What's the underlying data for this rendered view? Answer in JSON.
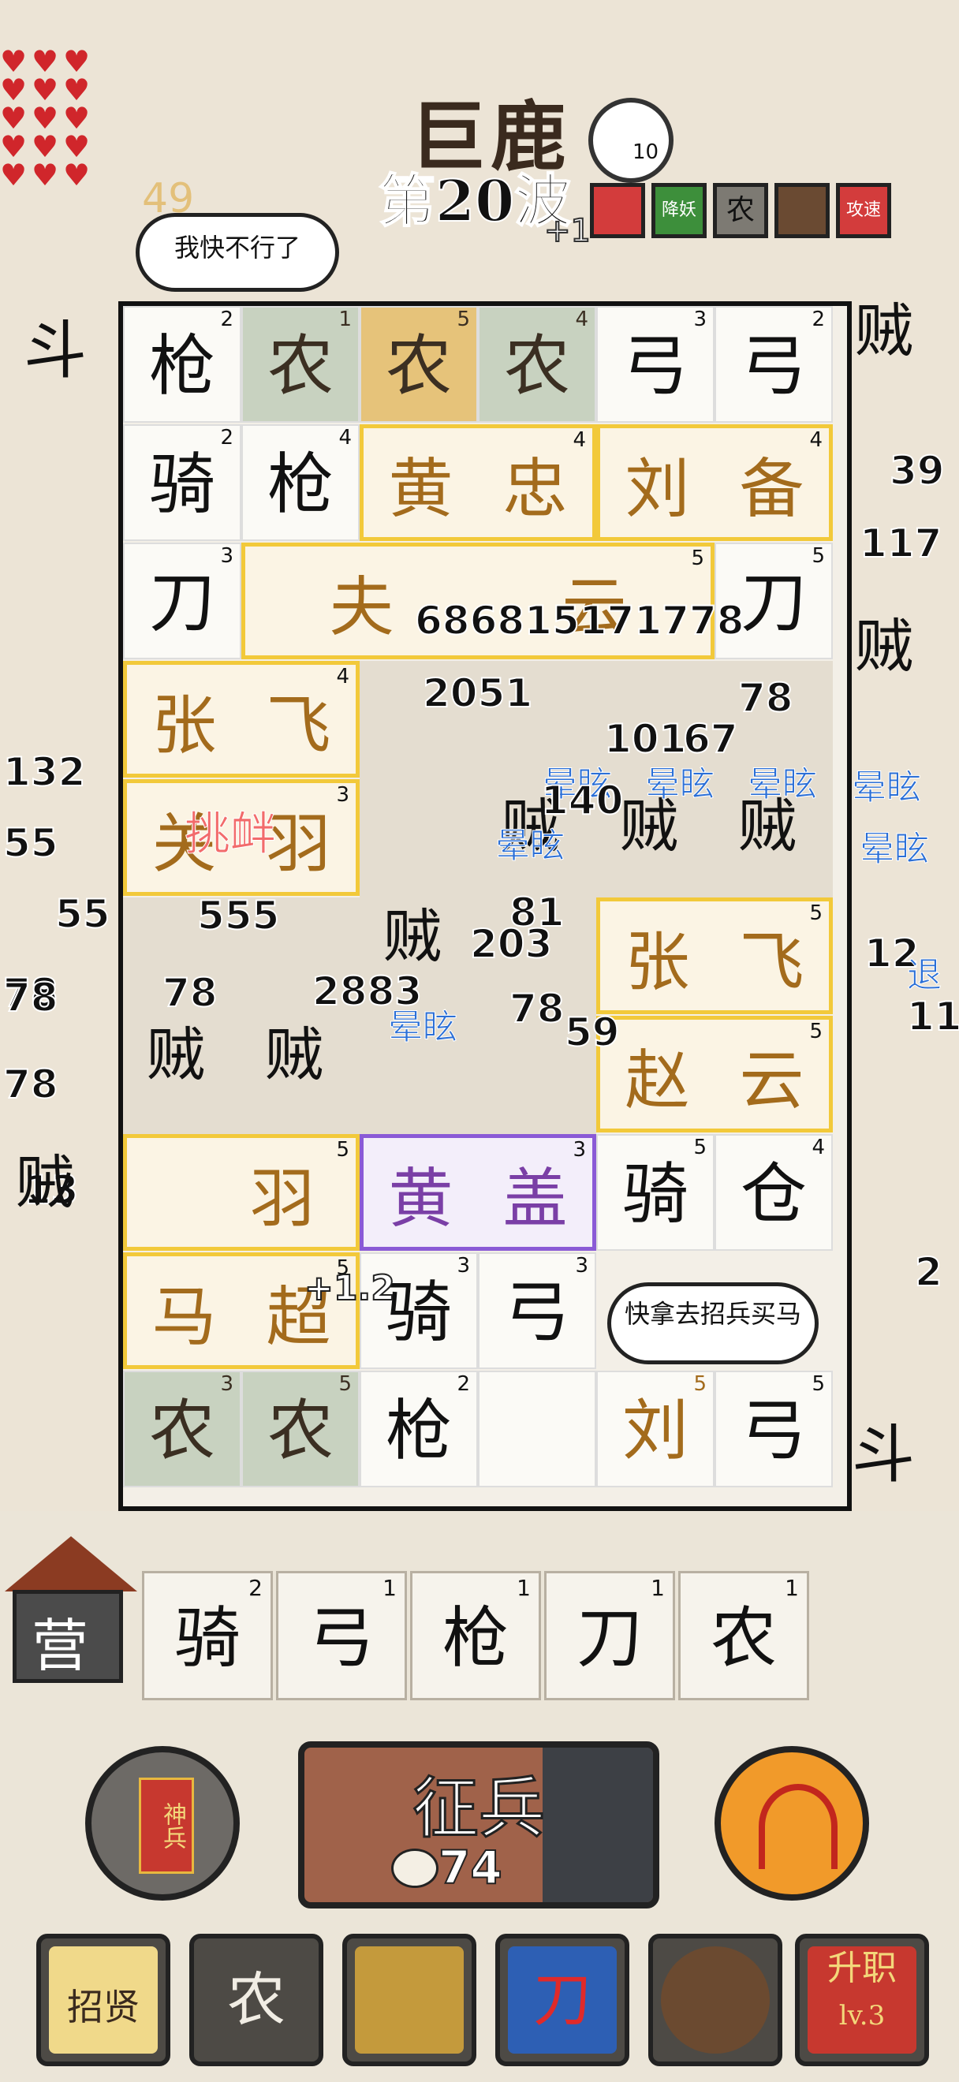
{
  "header": {
    "location": "巨鹿",
    "wave": "第20波",
    "gold": "49",
    "peach_count": "10",
    "income_hint": "+1"
  },
  "buffs": [
    "",
    "降妖",
    "农",
    "",
    "攻速"
  ],
  "bubbles": {
    "left": "我快不行了",
    "right": "快拿去招兵买马"
  },
  "board": {
    "row1": [
      {
        "char": "枪",
        "lv": "2"
      },
      {
        "char": "农",
        "lv": "1"
      },
      {
        "char": "农",
        "lv": "5"
      },
      {
        "char": "农",
        "lv": "4"
      },
      {
        "char": "弓",
        "lv": "3"
      },
      {
        "char": "弓",
        "lv": "2"
      }
    ],
    "row2": [
      {
        "char": "骑",
        "lv": "2"
      },
      {
        "char": "枪",
        "lv": "4"
      }
    ],
    "hero_huangzhong": {
      "name1": "黄",
      "name2": "忠",
      "lv": "4"
    },
    "hero_liubei": {
      "name1": "刘",
      "name2": "备",
      "lv": "4"
    },
    "row3_left": {
      "char": "刀",
      "lv": "3"
    },
    "hero_row3": {
      "name1": "夫",
      "name2": "云",
      "lv": "5"
    },
    "row3_right": {
      "char": "刀",
      "lv": "5"
    },
    "hero_zhangfei_a": {
      "name1": "张",
      "name2": "飞",
      "lv": "4"
    },
    "hero_guanyu": {
      "name1": "关",
      "name2": "羽",
      "lv": "3"
    },
    "hero_zhangfei_b": {
      "name1": "张",
      "name2": "飞",
      "lv": "5"
    },
    "hero_zhaoyun": {
      "name1": "赵",
      "name2": "云",
      "lv": "5"
    },
    "hero_yu": {
      "name1": "",
      "name2": "羽",
      "lv": "5"
    },
    "hero_huanggai": {
      "name1": "黄",
      "name2": "盖",
      "lv": "3"
    },
    "row7_right": [
      {
        "char": "骑",
        "lv": "5"
      },
      {
        "char": "仓",
        "lv": "4"
      }
    ],
    "hero_machao": {
      "name1": "马",
      "name2": "超",
      "lv": "5"
    },
    "row8": [
      {
        "char": "骑",
        "lv": "3"
      },
      {
        "char": "弓",
        "lv": "3"
      }
    ],
    "row9": [
      {
        "char": "农",
        "lv": "3"
      },
      {
        "char": "农",
        "lv": "5"
      },
      {
        "char": "枪",
        "lv": "2"
      },
      {
        "char": "",
        "lv": ""
      },
      {
        "char": "刘",
        "lv": "5"
      },
      {
        "char": "弓",
        "lv": "5"
      }
    ],
    "income_popup": "+1.2",
    "taunt": "挑衅"
  },
  "side_labels": {
    "left_top": "斗",
    "right_bottom": "斗"
  },
  "bandits": [
    "贼",
    "贼",
    "贼",
    "贼",
    "贼",
    "贼",
    "贼",
    "贼",
    "贼"
  ],
  "damage_numbers": [
    "2051",
    "101",
    "67",
    "78",
    "140",
    "686815171778",
    "2883",
    "203",
    "81",
    "78",
    "59",
    "4",
    "55",
    "55",
    "555",
    "78",
    "78",
    "78",
    "78",
    "13",
    "132",
    "39",
    "117",
    "12",
    "11",
    "2",
    "5"
  ],
  "status_stun": "晕眩",
  "status_retreat": "退",
  "queue": [
    {
      "char": "骑",
      "lv": "2"
    },
    {
      "char": "弓",
      "lv": "1"
    },
    {
      "char": "枪",
      "lv": "1"
    },
    {
      "char": "刀",
      "lv": "1"
    },
    {
      "char": "农",
      "lv": "1"
    }
  ],
  "camp_label": "营",
  "recruit": {
    "label": "征兵",
    "cost": "74"
  },
  "shenbing_label": "神兵",
  "skills": [
    {
      "label": "招贤"
    },
    {
      "label": "农"
    },
    {
      "label": ""
    },
    {
      "label": "刀"
    },
    {
      "label": ""
    },
    {
      "label": "升职",
      "sub": "lv.3"
    }
  ],
  "colors": {
    "hero_border": "#f2c93a",
    "hero_text": "#a36b1c",
    "purple_border": "#8a5ad6",
    "stun": "#2b6fd6",
    "heart": "#d0262b"
  }
}
